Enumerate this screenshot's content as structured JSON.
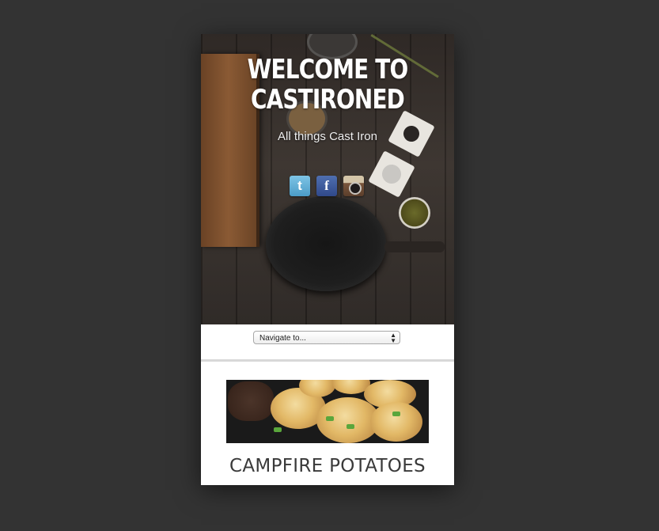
{
  "hero": {
    "title_line1": "WELCOME TO",
    "title_line2": "CASTIRONED",
    "tagline": "All things Cast Iron"
  },
  "social": {
    "twitter_glyph": "t",
    "facebook_glyph": "f",
    "icons": [
      "twitter-icon",
      "facebook-icon",
      "instagram-icon"
    ]
  },
  "nav": {
    "select_value": "Navigate to..."
  },
  "post": {
    "title": "CAMPFIRE POTATOES"
  },
  "colors": {
    "page_background": "#333333",
    "twitter": "#4b9cc7",
    "facebook": "#30498a"
  }
}
